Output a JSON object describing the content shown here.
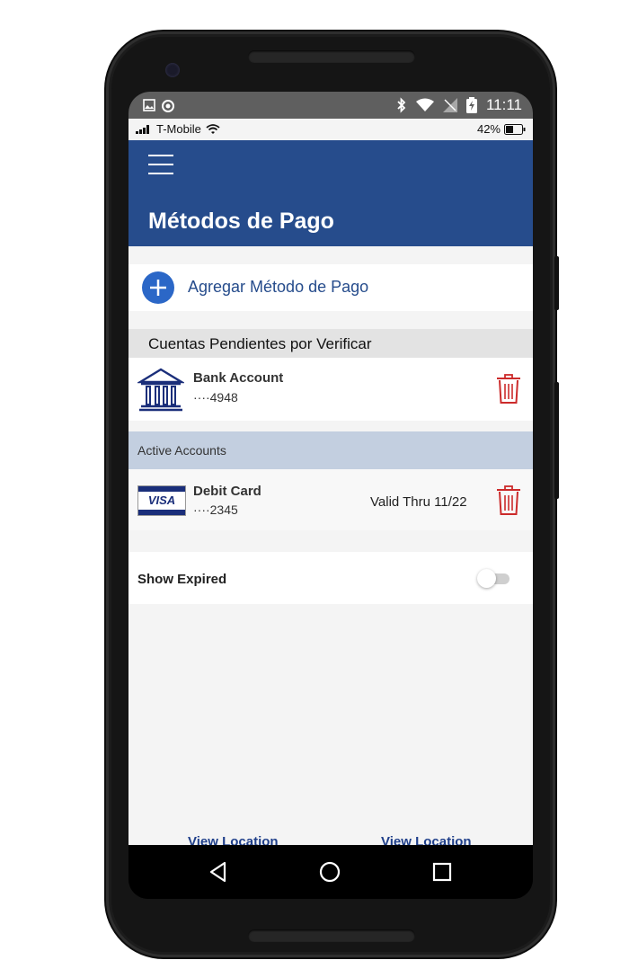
{
  "android_status": {
    "time": "11:11"
  },
  "ios_status": {
    "carrier": "T-Mobile",
    "battery": "42%"
  },
  "header": {
    "title": "Métodos de Pago"
  },
  "add_method": {
    "label": "Agregar Método de Pago"
  },
  "pending": {
    "heading": "Cuentas Pendientes por Verificar",
    "items": [
      {
        "name": "Bank Account",
        "number": "····4948"
      }
    ]
  },
  "active": {
    "heading": "Active Accounts",
    "items": [
      {
        "brand": "VISA",
        "name": "Debit Card",
        "number": "····2345",
        "valid": "Valid Thru 11/22"
      }
    ]
  },
  "show_expired": {
    "label": "Show Expired",
    "enabled": false
  },
  "bottom_links": [
    "View Location",
    "View Location"
  ],
  "colors": {
    "header": "#264c8c",
    "accent": "#2b67c7",
    "delete": "#cc2b2b",
    "active_band": "#c3cfe0"
  },
  "icons": [
    "menu-icon",
    "plus-icon",
    "bank-icon",
    "trash-icon",
    "visa-card-icon",
    "back-icon",
    "home-icon",
    "recents-icon"
  ]
}
